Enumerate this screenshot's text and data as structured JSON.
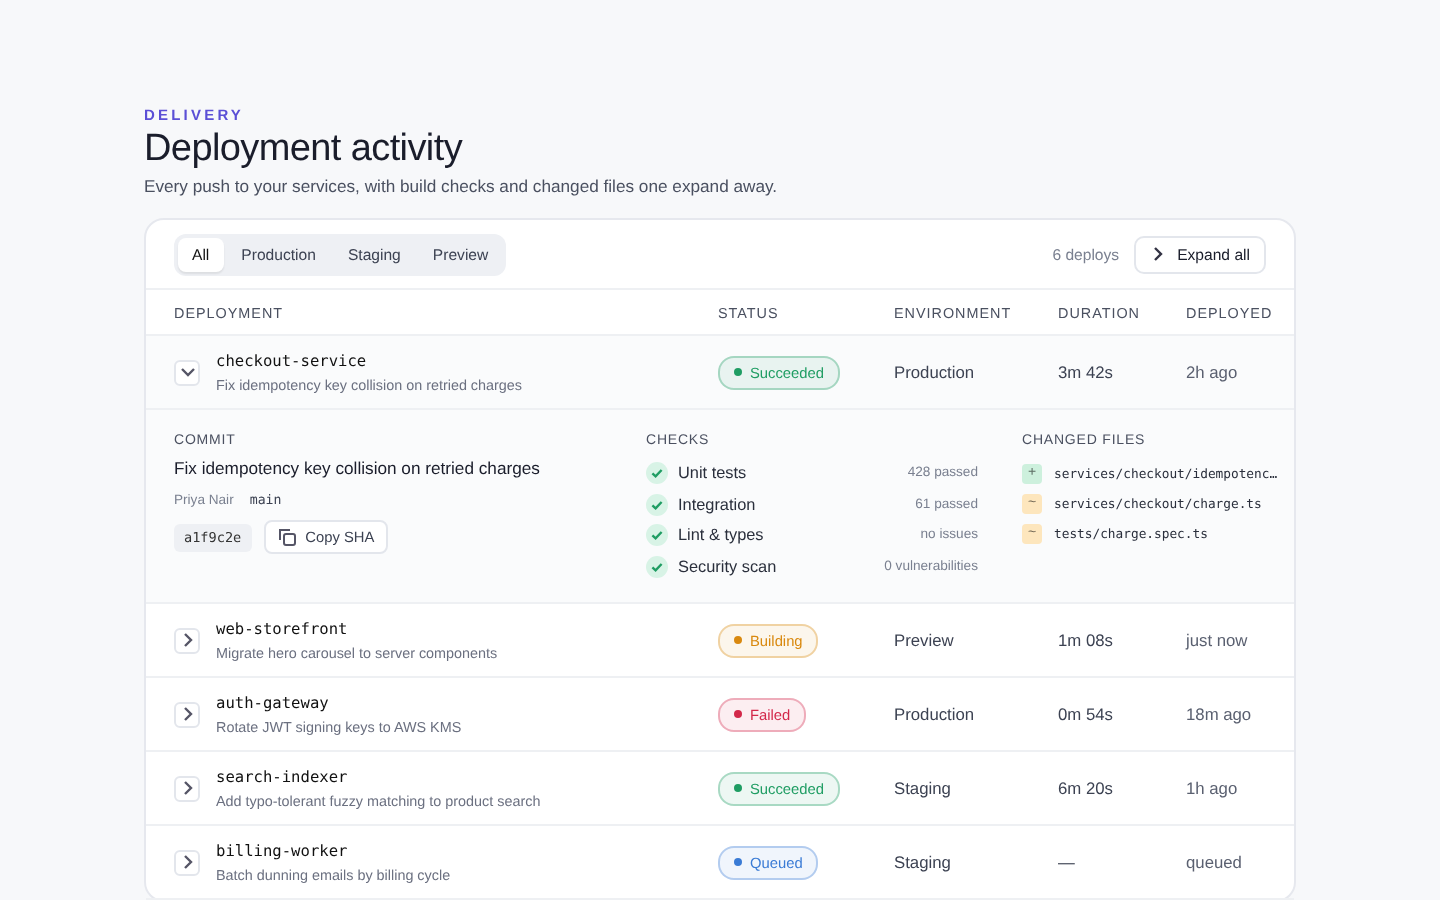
{
  "header": {
    "eyebrow": "DELIVERY",
    "title": "Deployment activity",
    "subtitle": "Every push to your services, with build checks and changed files one expand away."
  },
  "tabs": [
    {
      "label": "All",
      "selected": true
    },
    {
      "label": "Production",
      "selected": false
    },
    {
      "label": "Staging",
      "selected": false
    },
    {
      "label": "Preview",
      "selected": false
    }
  ],
  "deploy_count": "6 deploys",
  "expand_all": "Expand all",
  "columns": [
    "DEPLOYMENT",
    "STATUS",
    "ENVIRONMENT",
    "DURATION",
    "DEPLOYED"
  ],
  "rows": [
    {
      "service": "checkout-service",
      "message": "Fix idempotency key collision on retried charges",
      "status": "Succeeded",
      "color": "#1f9d63",
      "environment": "Production",
      "duration": "3m 42s",
      "deployed": "2h ago",
      "expanded": true,
      "details": {
        "commit_label": "COMMIT",
        "commit_message": "Fix idempotency key collision on retried charges",
        "author": "Priya Nair",
        "branch": "main",
        "sha": "a1f9c2e",
        "copy_label": "Copy SHA",
        "checks_label": "CHECKS",
        "checks": [
          {
            "name": "Unit tests",
            "result": "428 passed",
            "passed": true
          },
          {
            "name": "Integration",
            "result": "61 passed",
            "passed": true
          },
          {
            "name": "Lint & types",
            "result": "no issues",
            "passed": true
          },
          {
            "name": "Security scan",
            "result": "0 vulnerabilities",
            "passed": true
          }
        ],
        "files_label": "CHANGED FILES",
        "files": [
          {
            "path": "services/checkout/idempotenc…",
            "color": "#cdf0dd",
            "mark": "+"
          },
          {
            "path": "services/checkout/charge.ts",
            "color": "#fde6bd",
            "mark": "~"
          },
          {
            "path": "tests/charge.spec.ts",
            "color": "#fde6bd",
            "mark": "~"
          }
        ]
      }
    },
    {
      "service": "web-storefront",
      "message": "Migrate hero carousel to server components",
      "status": "Building",
      "color": "#d9890f",
      "environment": "Preview",
      "duration": "1m 08s",
      "deployed": "just now",
      "expanded": false
    },
    {
      "service": "auth-gateway",
      "message": "Rotate JWT signing keys to AWS KMS",
      "status": "Failed",
      "color": "#d3284a",
      "environment": "Production",
      "duration": "0m 54s",
      "deployed": "18m ago",
      "expanded": false
    },
    {
      "service": "search-indexer",
      "message": "Add typo-tolerant fuzzy matching to product search",
      "status": "Succeeded",
      "color": "#1f9d63",
      "environment": "Staging",
      "duration": "6m 20s",
      "deployed": "1h ago",
      "expanded": false
    },
    {
      "service": "billing-worker",
      "message": "Batch dunning emails by billing cycle",
      "status": "Queued",
      "color": "#3a7bd5",
      "environment": "Staging",
      "duration": "—",
      "deployed": "queued",
      "expanded": false
    }
  ]
}
